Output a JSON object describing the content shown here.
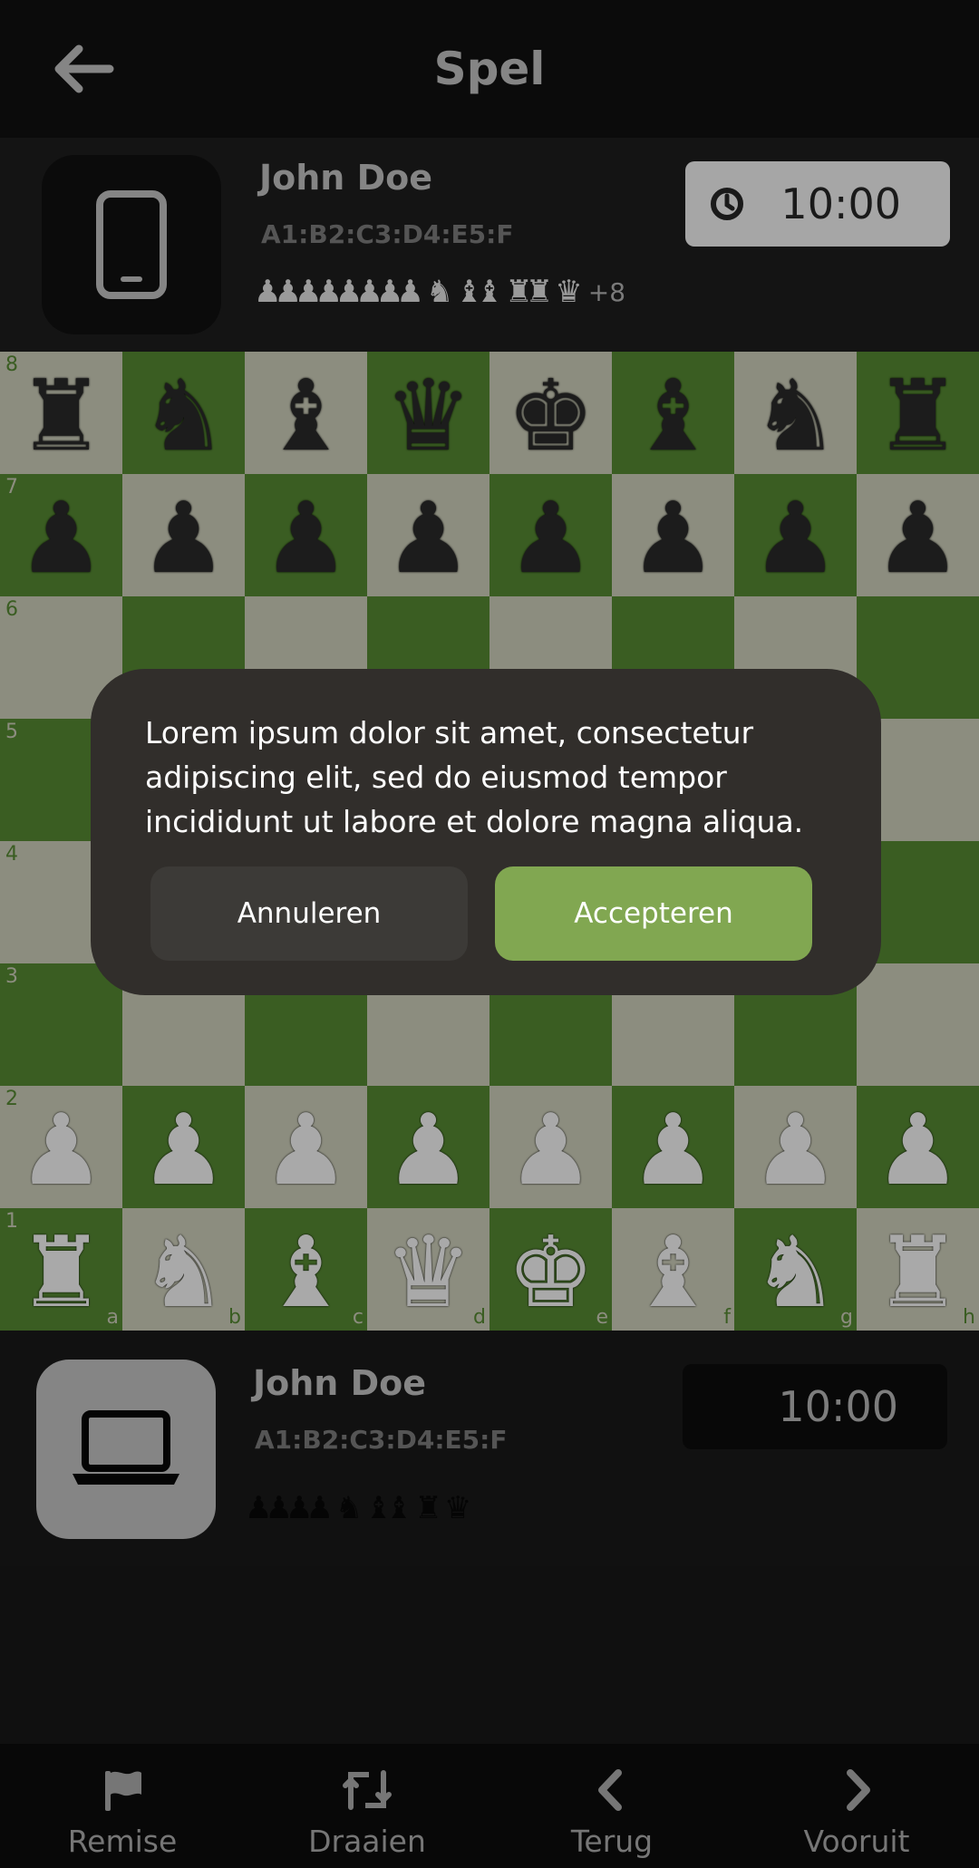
{
  "header": {
    "title": "Spel"
  },
  "opponent": {
    "name": "John Doe",
    "code": "A1:B2:C3:D4:E5:F",
    "avatar_icon": "smartphone-icon",
    "captured": {
      "pawns": "♟♟♟♟♟♟♟♟",
      "knights": "♞",
      "bishops": "♝♝",
      "rooks": "♜♜",
      "queen": "♛",
      "bonus": "+8"
    },
    "clock": "10:00"
  },
  "player": {
    "name": "John Doe",
    "code": "A1:B2:C3:D4:E5:F",
    "avatar_icon": "laptop-icon",
    "captured": {
      "pawns": "♟♟♟♟",
      "knights": "♞",
      "bishops": "♝♝",
      "rooks": "♜",
      "queen": "♛"
    },
    "clock": "10:00"
  },
  "board": {
    "files": [
      "a",
      "b",
      "c",
      "d",
      "e",
      "f",
      "g",
      "h"
    ],
    "ranks": [
      "8",
      "7",
      "6",
      "5",
      "4",
      "3",
      "2",
      "1"
    ],
    "position": [
      [
        "bR",
        "bN",
        "bB",
        "bQ",
        "bK",
        "bB",
        "bN",
        "bR"
      ],
      [
        "bP",
        "bP",
        "bP",
        "bP",
        "bP",
        "bP",
        "bP",
        "bP"
      ],
      [
        "",
        "",
        "",
        "",
        "",
        "",
        "",
        ""
      ],
      [
        "",
        "",
        "",
        "",
        "",
        "",
        "",
        ""
      ],
      [
        "",
        "",
        "",
        "",
        "",
        "",
        "",
        ""
      ],
      [
        "",
        "",
        "",
        "",
        "",
        "",
        "",
        ""
      ],
      [
        "wP",
        "wP",
        "wP",
        "wP",
        "wP",
        "wP",
        "wP",
        "wP"
      ],
      [
        "wR",
        "wN",
        "wB",
        "wQ",
        "wK",
        "wB",
        "wN",
        "wR"
      ]
    ],
    "colors": {
      "light": "#8c8d7f",
      "dark": "#3a5d22"
    }
  },
  "dialog": {
    "text": "Lorem ipsum dolor sit amet, consectetur adipiscing elit, sed do eiusmod tempor incididunt ut labore et dolore magna aliqua.",
    "cancel_label": "Annuleren",
    "accept_label": "Accepteren",
    "accept_color": "#81a751"
  },
  "nav": {
    "items": [
      {
        "label": "Remise",
        "icon": "flag-icon"
      },
      {
        "label": "Draaien",
        "icon": "rotate-icon"
      },
      {
        "label": "Terug",
        "icon": "chevron-left-icon"
      },
      {
        "label": "Vooruit",
        "icon": "chevron-right-icon"
      }
    ]
  }
}
